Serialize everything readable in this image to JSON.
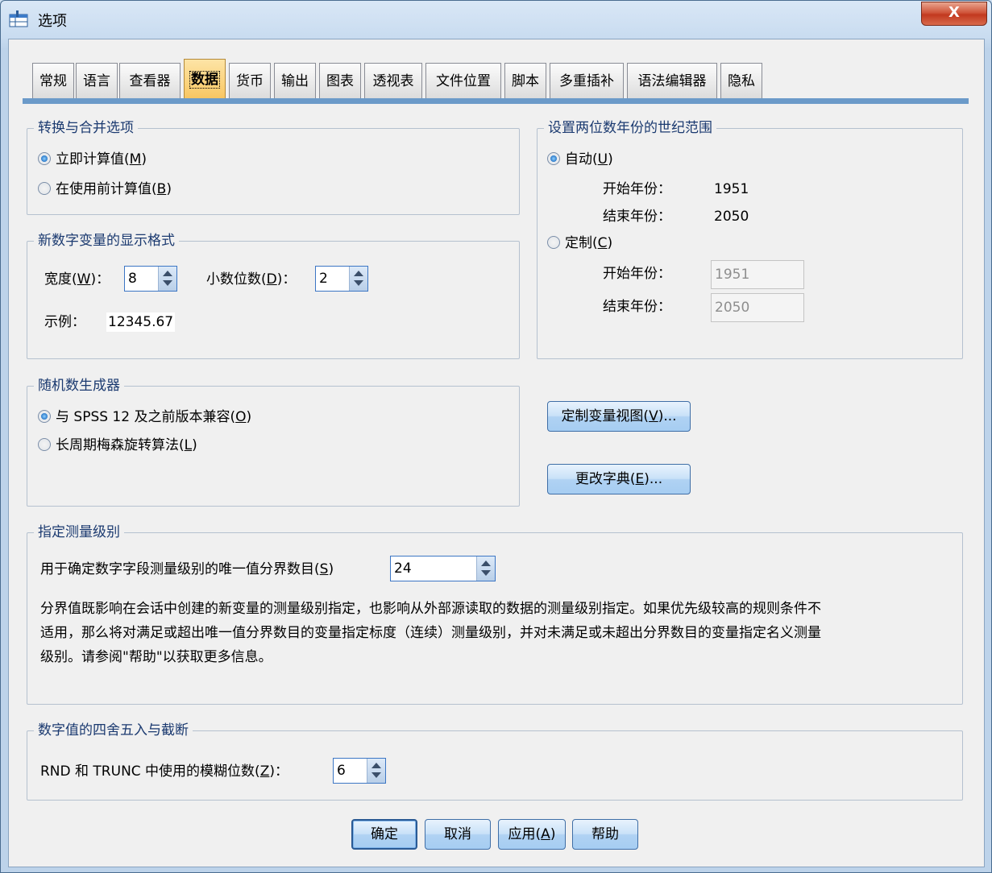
{
  "window": {
    "title": "选项",
    "close_label": "X"
  },
  "tabs": [
    {
      "label": "常规"
    },
    {
      "label": "语言"
    },
    {
      "label": "查看器"
    },
    {
      "label": "数据",
      "active": true
    },
    {
      "label": "货币"
    },
    {
      "label": "输出"
    },
    {
      "label": "图表"
    },
    {
      "label": "透视表"
    },
    {
      "label": "文件位置"
    },
    {
      "label": "脚本"
    },
    {
      "label": "多重插补"
    },
    {
      "label": "语法编辑器"
    },
    {
      "label": "隐私"
    }
  ],
  "transform": {
    "title": "转换与合并选项",
    "opt1": {
      "label": "立即计算值(",
      "key": "M",
      "end": ")",
      "selected": true
    },
    "opt2": {
      "label": "在使用前计算值(",
      "key": "B",
      "end": ")",
      "selected": false
    }
  },
  "numeric_format": {
    "title": "新数字变量的显示格式",
    "width_label": "宽度(",
    "width_key": "W",
    "width_end": ")：",
    "width_value": "8",
    "decimals_label": "小数位数(",
    "decimals_key": "D",
    "decimals_end": ")：",
    "decimals_value": "2",
    "sample_label": "示例：",
    "sample_value": "12345.67"
  },
  "random": {
    "title": "随机数生成器",
    "opt1": {
      "label": "与 SPSS 12 及之前版本兼容(",
      "key": "O",
      "end": ")",
      "selected": true
    },
    "opt2": {
      "label": "长周期梅森旋转算法(",
      "key": "L",
      "end": ")",
      "selected": false
    }
  },
  "century": {
    "title": "设置两位数年份的世纪范围",
    "auto": {
      "label": "自动(",
      "key": "U",
      "end": ")",
      "selected": true
    },
    "start_label": "开始年份：",
    "end_label": "结束年份：",
    "auto_start": "1951",
    "auto_end": "2050",
    "custom": {
      "label": "定制(",
      "key": "C",
      "end": ")",
      "selected": false
    },
    "custom_start": "1951",
    "custom_end": "2050"
  },
  "buttons": {
    "customize_view": {
      "label": "定制变量视图(",
      "key": "V",
      "end": ")..."
    },
    "change_dict": {
      "label": "更改字典(",
      "key": "E",
      "end": ")..."
    }
  },
  "measure": {
    "title": "指定测量级别",
    "threshold_label": "用于确定数字字段测量级别的唯一值分界数目(",
    "threshold_key": "S",
    "threshold_end": ")",
    "threshold_value": "24",
    "line1": "分界值既影响在会话中创建的新变量的测量级别指定，也影响从外部源读取的数据的测量级别指定。如果优先级较高的规则条件不",
    "line2": "适用，那么将对满足或超出唯一值分界数目的变量指定标度（连续）测量级别，并对未满足或未超出分界数目的变量指定名义测量",
    "line3": "级别。请参阅\"帮助\"以获取更多信息。"
  },
  "rounding": {
    "title": "数字值的四舍五入与截断",
    "label": "RND 和 TRUNC 中使用的模糊位数(",
    "key": "Z",
    "end": ")：",
    "value": "6"
  },
  "footer": {
    "ok": "确定",
    "cancel": "取消",
    "apply_label": "应用(",
    "apply_key": "A",
    "apply_end": ")",
    "help": "帮助"
  }
}
